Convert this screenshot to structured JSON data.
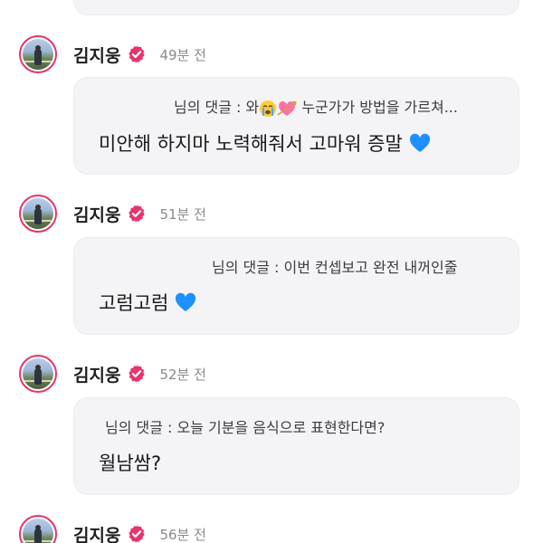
{
  "colors": {
    "accent": "#e8336d",
    "bubble_bg": "#f4f4f6",
    "heart_blue": "#1e90ff",
    "muted_text": "#8a8a8f"
  },
  "comments": [
    {
      "username": "김지웅",
      "time": "49분 전",
      "reply_prefix": "님의 댓글 : 와",
      "reply_emojis": [
        "loudly-crying-face",
        "heart-with-arrow"
      ],
      "reply_suffix": " 누군가가 방법을 가르쳐...",
      "message": "미안해 하지마 노력해줘서 고마워 증말",
      "message_icon": "blue-heart-icon"
    },
    {
      "username": "김지웅",
      "time": "51분 전",
      "reply_prefix": "님의 댓글 : 이번 컨셉보고 완전 내꺼인줄",
      "message": "고럼고럼",
      "message_icon": "blue-heart-icon"
    },
    {
      "username": "김지웅",
      "time": "52분 전",
      "reply_prefix": "님의 댓글 : 오늘 기분을 음식으로 표현한다면?",
      "message": "월남쌈?"
    },
    {
      "username": "김지웅",
      "time": "56분 전"
    }
  ]
}
